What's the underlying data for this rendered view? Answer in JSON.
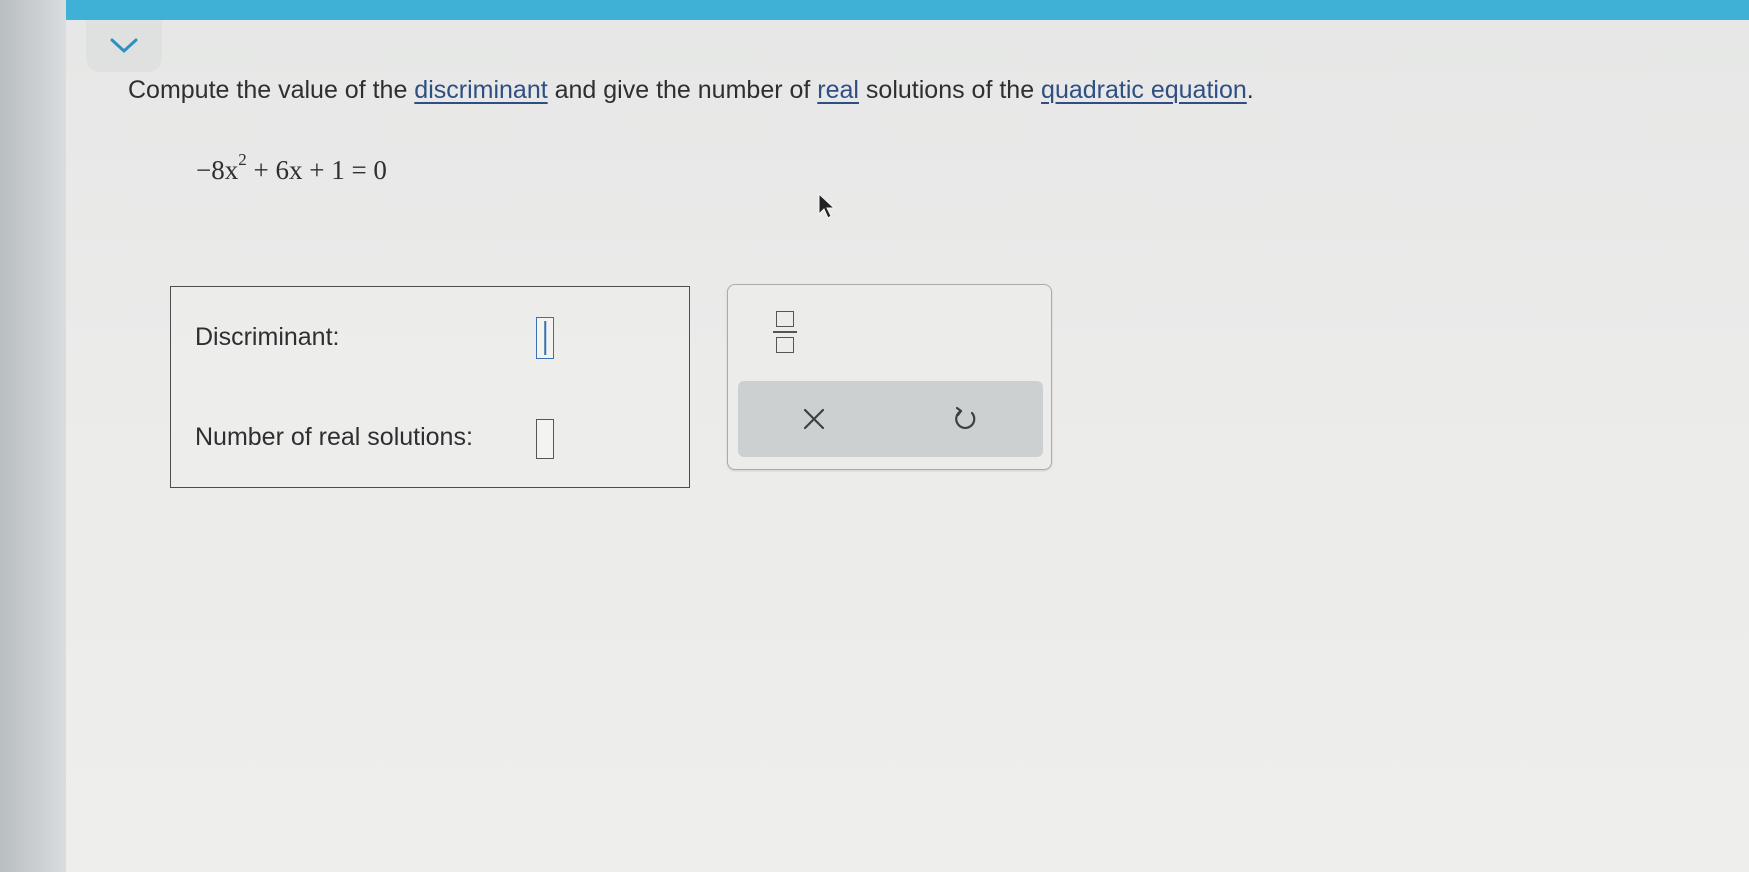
{
  "question": {
    "text_before": "Compute the value of the ",
    "link_discriminant": "discriminant",
    "text_middle1": " and give the number of ",
    "link_real": "real",
    "text_middle2": " solutions of the ",
    "link_quadratic": "quadratic equation",
    "text_end": "."
  },
  "equation": {
    "part1": "−8x",
    "exponent": "2",
    "part2": " + 6x + 1 = 0"
  },
  "answers": {
    "discriminant_label": "Discriminant:",
    "discriminant_value": "",
    "solutions_label": "Number of real solutions:",
    "solutions_value": ""
  },
  "keypad": {
    "icons": [
      "fraction-icon",
      "clear-icon",
      "undo-icon"
    ]
  },
  "colors": {
    "accent_bar": "#3fb0d6",
    "link": "#2f4f82",
    "active_input": "#3a6fb0"
  }
}
